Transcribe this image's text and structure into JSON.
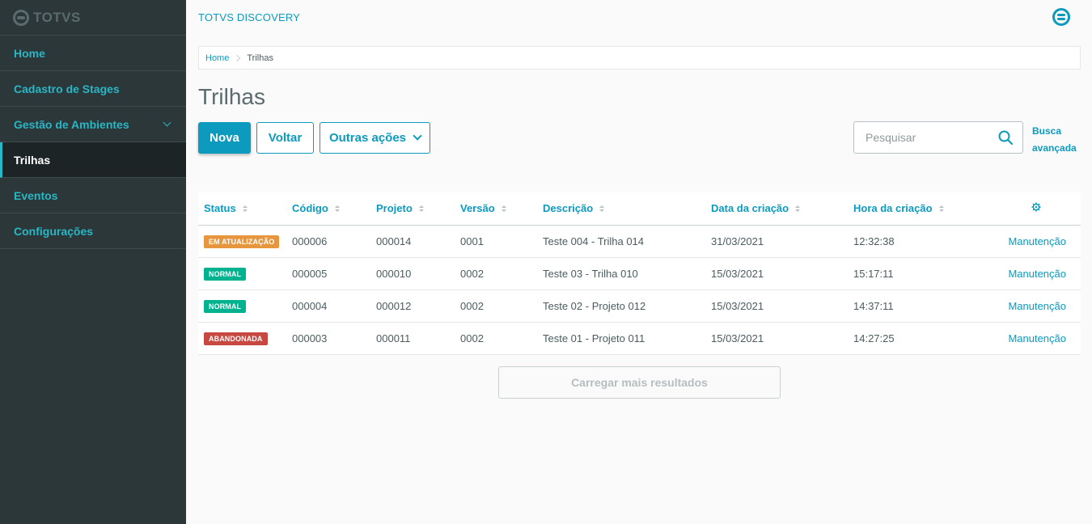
{
  "brand": {
    "logo_text": "TOTVS"
  },
  "sidebar": {
    "items": [
      {
        "label": "Home"
      },
      {
        "label": "Cadastro de Stages"
      },
      {
        "label": "Gestão de Ambientes"
      },
      {
        "label": "Trilhas"
      },
      {
        "label": "Eventos"
      },
      {
        "label": "Configurações"
      }
    ],
    "active": "Trilhas"
  },
  "header": {
    "app_title": "TOTVS DISCOVERY"
  },
  "breadcrumb": {
    "home": "Home",
    "current": "Trilhas"
  },
  "page": {
    "title": "Trilhas"
  },
  "toolbar": {
    "new_label": "Nova",
    "back_label": "Voltar",
    "more_label": "Outras ações",
    "search_placeholder": "Pesquisar",
    "advanced_search_line1": "Busca",
    "advanced_search_line2": "avançada"
  },
  "table": {
    "columns": [
      "Status",
      "Código",
      "Projeto",
      "Versão",
      "Descrição",
      "Data da criação",
      "Hora da criação"
    ],
    "rows": [
      {
        "status": "EM ATUALIZAÇÃO",
        "status_color": "#e7963d",
        "codigo": "000006",
        "projeto": "000014",
        "versao": "0001",
        "descricao": "Teste 004 - Trilha 014",
        "data": "31/03/2021",
        "hora": "12:32:38",
        "action": "Manutenção"
      },
      {
        "status": "NORMAL",
        "status_color": "#00b28e",
        "codigo": "000005",
        "projeto": "000010",
        "versao": "0002",
        "descricao": "Teste 03 - Trilha 010",
        "data": "15/03/2021",
        "hora": "15:17:11",
        "action": "Manutenção"
      },
      {
        "status": "NORMAL",
        "status_color": "#00b28e",
        "codigo": "000004",
        "projeto": "000012",
        "versao": "0002",
        "descricao": "Teste 02 - Projeto 012",
        "data": "15/03/2021",
        "hora": "14:37:11",
        "action": "Manutenção"
      },
      {
        "status": "ABANDONADA",
        "status_color": "#c64840",
        "codigo": "000003",
        "projeto": "000011",
        "versao": "0002",
        "descricao": "Teste 01 - Projeto 011",
        "data": "15/03/2021",
        "hora": "14:27:25",
        "action": "Manutenção"
      }
    ]
  },
  "footer": {
    "load_more": "Carregar mais resultados"
  },
  "colors": {
    "primary": "#0c9abe",
    "sidebar_bg": "#2c3739",
    "sidebar_link": "#29b6c5"
  }
}
